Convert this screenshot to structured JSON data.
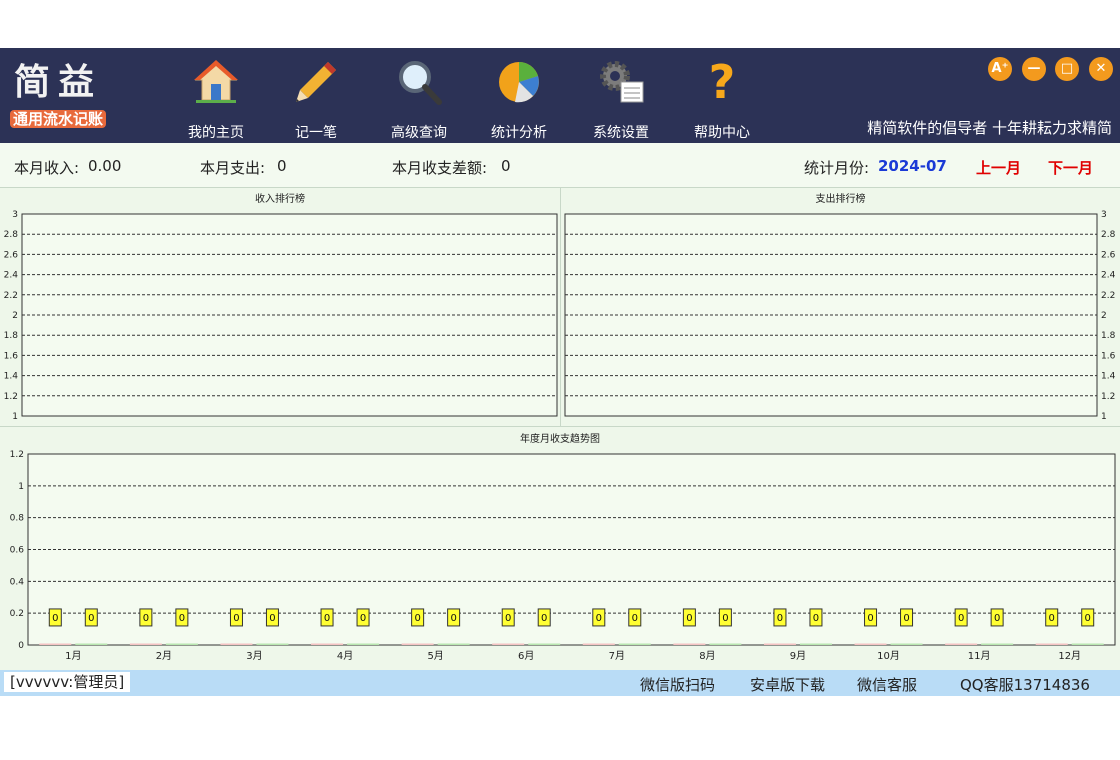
{
  "app": {
    "logo_main": "简益",
    "logo_sub": "通用流水记账",
    "slogan": "精简软件的倡导者  十年耕耘力求精简"
  },
  "toolbar": [
    {
      "label": "我的主页",
      "icon": "home-icon"
    },
    {
      "label": "记一笔",
      "icon": "pencil-icon"
    },
    {
      "label": "高级查询",
      "icon": "magnifier-icon"
    },
    {
      "label": "统计分析",
      "icon": "pie-chart-icon"
    },
    {
      "label": "系统设置",
      "icon": "gear-icon"
    },
    {
      "label": "帮助中心",
      "icon": "question-icon"
    }
  ],
  "window_controls": {
    "font": "A⁺",
    "minimize": "—",
    "maximize": "□",
    "close": "✕"
  },
  "summary": {
    "income_label": "本月收入:",
    "income_value": "0.00",
    "expense_label": "本月支出:",
    "expense_value": "0",
    "diff_label": "本月收支差额:",
    "diff_value": "0",
    "month_label": "统计月份:",
    "month_value": "2024-07",
    "prev_month": "上一月",
    "next_month": "下一月"
  },
  "chart_data": [
    {
      "type": "bar",
      "title": "收入排行榜",
      "categories": [],
      "values": [],
      "ylim": [
        1,
        3
      ],
      "yticks": [
        "1",
        "1.2",
        "1.4",
        "1.6",
        "1.8",
        "2",
        "2.2",
        "2.4",
        "2.6",
        "2.8",
        "3"
      ],
      "grid": true
    },
    {
      "type": "bar",
      "title": "支出排行榜",
      "categories": [],
      "values": [],
      "ylim": [
        1,
        3
      ],
      "yticks": [
        "1",
        "1.2",
        "1.4",
        "1.6",
        "1.8",
        "2",
        "2.2",
        "2.4",
        "2.6",
        "2.8",
        "3"
      ],
      "grid": true
    },
    {
      "type": "bar",
      "title": "年度月收支趋势图",
      "categories": [
        "1月",
        "2月",
        "3月",
        "4月",
        "5月",
        "6月",
        "7月",
        "8月",
        "9月",
        "10月",
        "11月",
        "12月"
      ],
      "series": [
        {
          "values": [
            0,
            0,
            0,
            0,
            0,
            0,
            0,
            0,
            0,
            0,
            0,
            0
          ],
          "color": "#f4c2c2"
        },
        {
          "values": [
            0,
            0,
            0,
            0,
            0,
            0,
            0,
            0,
            0,
            0,
            0,
            0
          ],
          "color": "#b8e6b0"
        }
      ],
      "data_labels": "0",
      "ylim": [
        0,
        1.2
      ],
      "yticks": [
        "0",
        "0.2",
        "0.4",
        "0.6",
        "0.8",
        "1",
        "1.2"
      ],
      "grid": true
    }
  ],
  "statusbar": {
    "user": "[vvvvvv:管理员]",
    "wechat_scan": "微信版扫码",
    "android_download": "安卓版下载",
    "wechat_service": "微信客服",
    "qq_service": "QQ客服13714836"
  }
}
